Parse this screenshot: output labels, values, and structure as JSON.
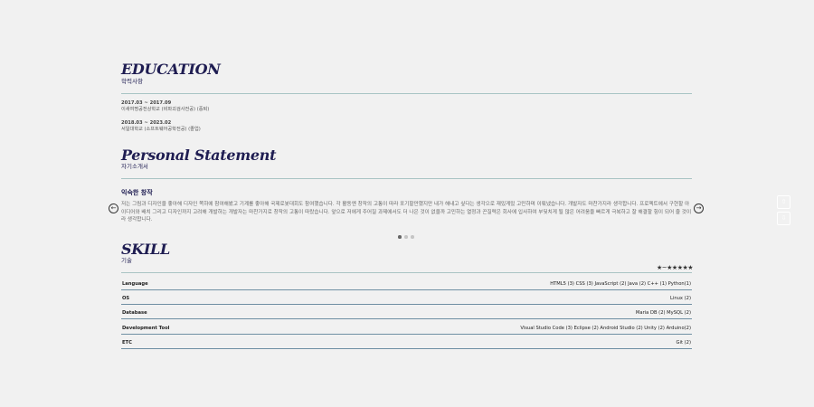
{
  "education": {
    "title": "EDUCATION",
    "subtitle": "학력사항",
    "entries": [
      {
        "period": "2017.03 ~ 2017.09",
        "school": "이새여명공전상학교 (비파괴검사전공) (중퇴)"
      },
      {
        "period": "2018.03 ~ 2023.02",
        "school": "서일대학교 (소프트웨어공학전공) (졸업)"
      }
    ]
  },
  "statement": {
    "title": "Personal Statement",
    "subtitle": "자기소개서",
    "slide_heading": "익숙한 창작",
    "slide_text": "저는 그림과 디자인을 좋아해 디자인 쪽하에 참여해봤고 기계를 좋아해 국제로봇대회도 참여했습니다. 각 활동엔 창작의 고통이 따라 포기할만했지만 내가 해내고 싶다는 생각으로 재밌게밌 고민하며 이뤄냈습니다. 개발자도 마찬가지라 생각합니다. 프로젝트에서 구현할 아이디어와 배치 그리고 디자인까지 고려해 개발하는 개발자는 마찬가지로 창작의 고통이 따랐습니다. 앞으로 저에게 주어질 과제에서도 더 나은 것이 없을까 고민하는 열정과 끈질력은 회사에 입사하여 부딪치게 될 많은 어려움을 빠르게 극복하고 잘 해결할 힘이 되어 줄 것이라 생각합니다.",
    "prev_icon": "arrow-left-circle",
    "next_icon": "arrow-right-circle",
    "dots": 3,
    "active_dot": 0
  },
  "skill": {
    "title": "SKILL",
    "subtitle": "기술",
    "legend": "★~★★★★★",
    "rows": [
      {
        "category": "Language",
        "value": "HTML5 (3)  CSS (3)  JavaScript (2)  Java (2)  C++ (1)  Python(1)"
      },
      {
        "category": "OS",
        "value": "Linux (2)"
      },
      {
        "category": "Database",
        "value": "Maria DB (2)  MySQL (2)"
      },
      {
        "category": "Development Tool",
        "value": "Visual Studio Code (3)  Eclipse (2)  Android Studio (2)  Unity (2)  Arduino(2)"
      },
      {
        "category": "ETC",
        "value": "Git (2)"
      }
    ]
  },
  "side_buttons": {
    "top_icon": "arrow-up-icon",
    "bottom_icon": "arrow-down-icon",
    "top_glyph": "⇧",
    "bottom_glyph": "⇩"
  },
  "colors": {
    "background": "#f1f1f1",
    "heading": "#1f1d52",
    "rule": "#a9c4c4",
    "row_border": "#6f8fa3"
  }
}
